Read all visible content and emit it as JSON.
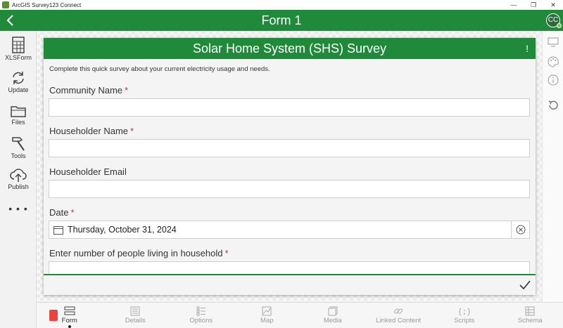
{
  "window": {
    "title": "ArcGIS Survey123 Connect",
    "controls": [
      "—",
      "❐",
      "✕"
    ]
  },
  "header": {
    "title": "Form 1",
    "avatar_initials": "CC"
  },
  "sidebar": {
    "items": [
      {
        "label": "XLSForm",
        "icon": "spreadsheet-icon"
      },
      {
        "label": "Update",
        "icon": "refresh-icon"
      },
      {
        "label": "Files",
        "icon": "folder-icon"
      },
      {
        "label": "Tools",
        "icon": "hammer-icon"
      },
      {
        "label": "Publish",
        "icon": "cloud-upload-icon"
      }
    ],
    "more": "• • •"
  },
  "form": {
    "title": "Solar Home System (SHS) Survey",
    "header_icon": "!",
    "intro": "Complete this quick survey about your current electricity usage and needs.",
    "questions": [
      {
        "label": "Community Name",
        "required": "*",
        "value": ""
      },
      {
        "label": "Householder Name",
        "required": "*",
        "value": ""
      },
      {
        "label": "Householder Email",
        "required": "",
        "value": ""
      },
      {
        "label": "Date",
        "required": "*",
        "value": "Thursday, October 31, 2024"
      },
      {
        "label": "Enter number of people living in household",
        "required": "*",
        "value": ""
      }
    ]
  },
  "tabs": [
    {
      "label": "Form",
      "active": true
    },
    {
      "label": "Details"
    },
    {
      "label": "Options"
    },
    {
      "label": "Map"
    },
    {
      "label": "Media"
    },
    {
      "label": "Linked Content"
    },
    {
      "label": "Scripts"
    },
    {
      "label": "Schema"
    }
  ],
  "colors": {
    "brand_green": "#1f8a3a",
    "required_red": "#c0392b",
    "tab_inactive": "#9a9a9a"
  }
}
